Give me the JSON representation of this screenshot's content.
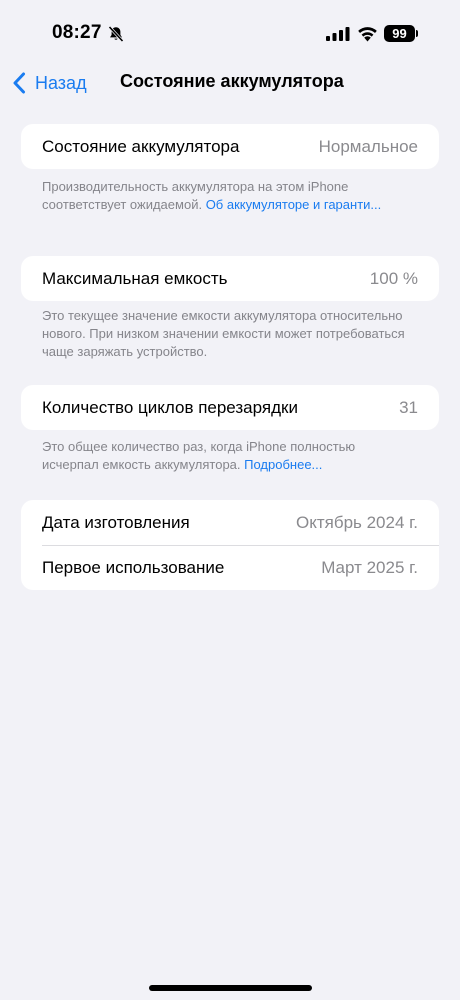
{
  "status_bar": {
    "time": "08:27",
    "battery_level": "99",
    "icons": [
      "bell-slash-icon",
      "cellular-signal-icon",
      "wifi-icon",
      "battery-icon"
    ]
  },
  "nav": {
    "back_label": "Назад",
    "title": "Состояние аккумулятора"
  },
  "battery_health": {
    "label": "Состояние аккумулятора",
    "value": "Нормальное",
    "footnote_text": "Производительность аккумулятора на этом iPhone соответствует ожидаемой. ",
    "footnote_link": "Об аккумуляторе и гаранти..."
  },
  "max_capacity": {
    "label": "Максимальная емкость",
    "value": "100 %",
    "footnote_text": "Это текущее значение емкости аккумулятора относительно нового. При низком значении емкости может потребоваться чаще заряжать устройство."
  },
  "cycle_count": {
    "label": "Количество циклов перезарядки",
    "value": "31",
    "footnote_text": "Это общее количество раз, когда iPhone полностью исчерпал емкость аккумулятора. ",
    "footnote_link": "Подробнее..."
  },
  "dates": {
    "manufacture_label": "Дата изготовления",
    "manufacture_value": "Октябрь 2024 г.",
    "first_use_label": "Первое использование",
    "first_use_value": "Март 2025 г."
  },
  "colors": {
    "background": "#f2f2f7",
    "card": "#ffffff",
    "accent": "#1a7cf0",
    "secondary_text": "#8a8a8e"
  }
}
